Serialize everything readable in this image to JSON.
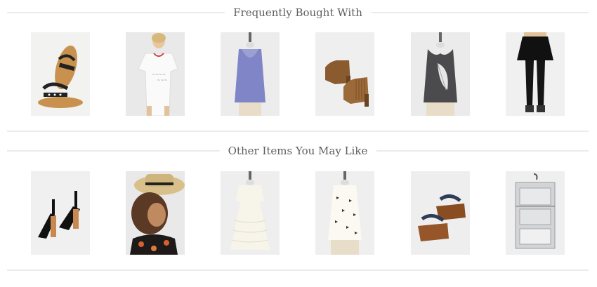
{
  "sections": [
    {
      "title": "Frequently Bought With",
      "items": [
        {
          "product": "sandals-icon",
          "bg": "#f0f0ef"
        },
        {
          "product": "tshirt-dress-icon",
          "bg": "#ececec"
        },
        {
          "product": "periwinkle-tank-icon",
          "bg": "#ececec"
        },
        {
          "product": "fringe-booties-icon",
          "bg": "#efefef"
        },
        {
          "product": "feather-tank-icon",
          "bg": "#ededed"
        },
        {
          "product": "skirt-leggings-icon",
          "bg": "#f0f0f0"
        }
      ]
    },
    {
      "title": "Other Items You May Like",
      "items": [
        {
          "product": "block-heels-icon",
          "bg": "#f0f0f0"
        },
        {
          "product": "straw-hat-model-icon",
          "bg": "#ececec"
        },
        {
          "product": "lace-dress-icon",
          "bg": "#eeeeee"
        },
        {
          "product": "bird-print-top-icon",
          "bg": "#efefef"
        },
        {
          "product": "platform-wedges-icon",
          "bg": "#eeeeee"
        },
        {
          "product": "travel-organizer-icon",
          "bg": "#efefef"
        }
      ]
    }
  ],
  "colors": {
    "rule": "#ebebeb",
    "heading": "#5d5d5d"
  }
}
